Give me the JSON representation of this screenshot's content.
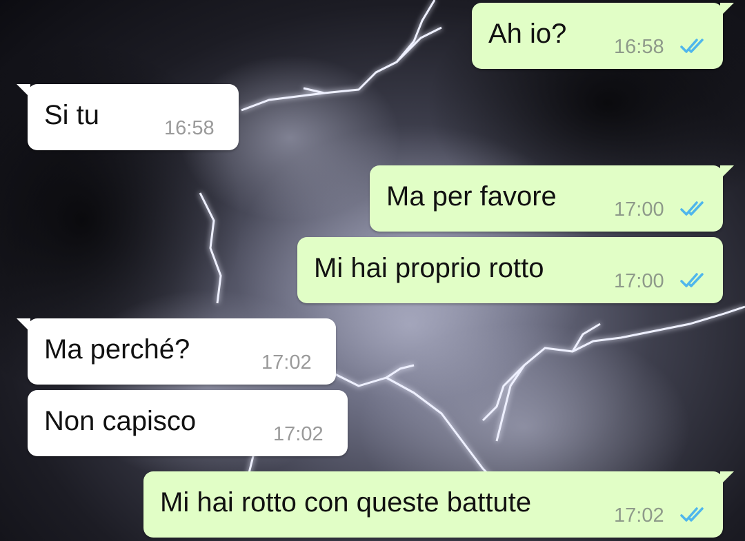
{
  "chat": {
    "messages": [
      {
        "direction": "outgoing",
        "text": "Ah io?",
        "time": "16:58",
        "status": "read",
        "status_icon": "double-check-icon",
        "tick_color": "#4fb6ec"
      },
      {
        "direction": "incoming",
        "text": "Si tu",
        "time": "16:58"
      },
      {
        "direction": "outgoing",
        "text": "Ma per favore",
        "time": "17:00",
        "status": "read",
        "status_icon": "double-check-icon",
        "tick_color": "#4fb6ec"
      },
      {
        "direction": "outgoing",
        "text": "Mi hai proprio rotto",
        "time": "17:00",
        "status": "read",
        "status_icon": "double-check-icon",
        "tick_color": "#4fb6ec"
      },
      {
        "direction": "incoming",
        "text": "Ma perché?",
        "time": "17:02"
      },
      {
        "direction": "incoming",
        "text": "Non capisco",
        "time": "17:02"
      },
      {
        "direction": "outgoing",
        "text": "Mi hai rotto con queste battute",
        "time": "17:02",
        "status": "read",
        "status_icon": "double-check-icon",
        "tick_color": "#4fb6ec"
      }
    ]
  },
  "theme": {
    "outgoing_bubble": "#e1fec6",
    "incoming_bubble": "#ffffff",
    "wallpaper": "lightning-storm"
  }
}
